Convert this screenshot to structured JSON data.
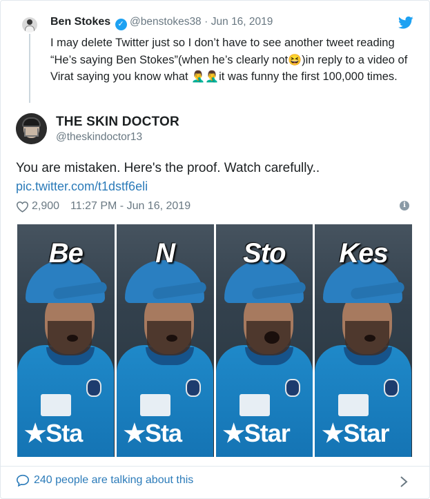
{
  "quoted_tweet": {
    "name": "Ben Stokes",
    "handle": "@benstokes38",
    "separator": "·",
    "date": "Jun 16, 2019",
    "text_part1": "I may delete Twitter just so I don’t have to see another tweet reading “He’s saying Ben Stokes”(when he’s clearly not",
    "emoji1": "😆",
    "text_part2": ")in reply to a video of Virat saying you know what ",
    "emoji2": "🤦‍♂️",
    "emoji3": "🤦‍♂️",
    "text_part3": "it was funny the first 100,000 times."
  },
  "main_tweet": {
    "name": "THE SKIN DOCTOR",
    "handle": "@theskindoctor13",
    "text": "You are mistaken. Here's the proof. Watch carefully..",
    "link": "pic.twitter.com/t1dstf6eli",
    "likes": "2,900",
    "timestamp": "11:27 PM - Jun 16, 2019"
  },
  "media": {
    "panels": [
      {
        "label": "Be",
        "jersey_text": "★Sta"
      },
      {
        "label": "N",
        "jersey_text": "★Sta"
      },
      {
        "label": "Sto",
        "jersey_text": "★Star"
      },
      {
        "label": "Kes",
        "jersey_text": "★Star"
      }
    ]
  },
  "footer": {
    "talking": "240 people are talking about this"
  },
  "colors": {
    "link": "#2b7bb9",
    "muted": "#697882",
    "twitter_blue": "#1da1f2"
  }
}
